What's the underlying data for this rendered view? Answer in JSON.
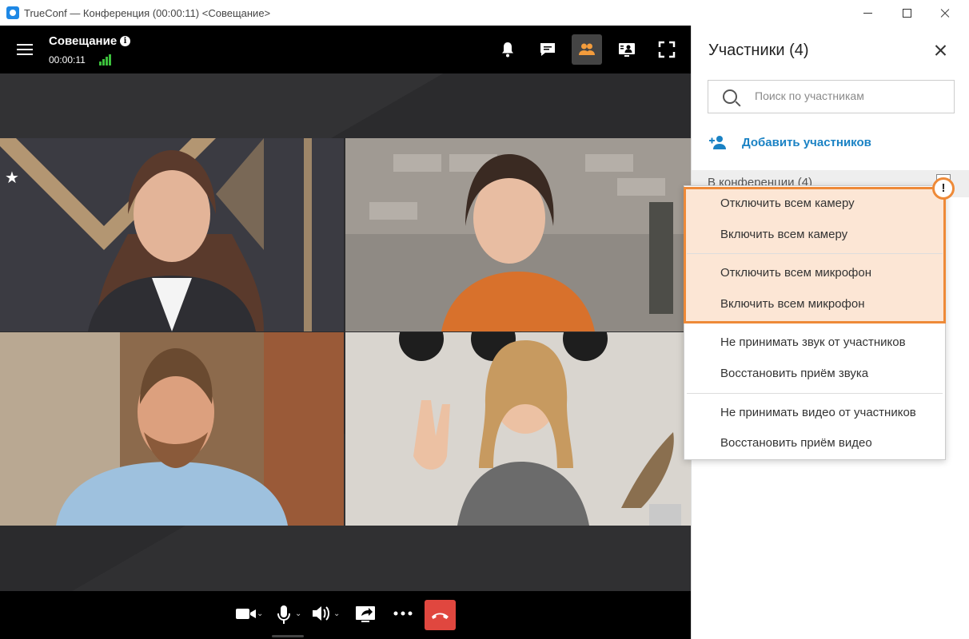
{
  "window": {
    "title": "TrueConf — Конференция (00:00:11) <Совещание>"
  },
  "conference": {
    "name": "Совещание",
    "timer": "00:00:11"
  },
  "toolbar": {
    "buttons": [
      "bell-icon",
      "chat-icon",
      "participants-icon",
      "content-icon",
      "fullscreen-icon"
    ],
    "active": "participants-icon"
  },
  "bottom_bar": {
    "buttons": [
      "camera-icon",
      "microphone-icon",
      "speaker-icon",
      "share-screen-icon",
      "more-icon",
      "end-call-icon"
    ],
    "end_call_color": "#e0473f"
  },
  "participants_panel": {
    "title": "Участники (4)",
    "search_placeholder": "Поиск по участникам",
    "add_label": "Добавить участников",
    "section_label": "В конференции (4)"
  },
  "context_menu": {
    "items": [
      "Отключить всем камеру",
      "Включить всем камеру",
      "Отключить всем микрофон",
      "Включить всем микрофон",
      "Не принимать звук от участников",
      "Восстановить приём звука",
      "Не принимать видео от участников",
      "Восстановить приём видео"
    ],
    "highlight_color": "#ee8a38",
    "warning_badge": "!"
  },
  "colors": {
    "accent": "#1a82c4",
    "signal": "#3cc03c"
  }
}
